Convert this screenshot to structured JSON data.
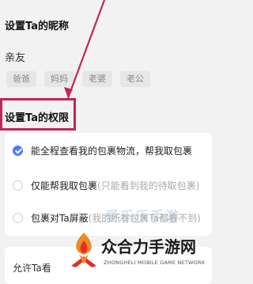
{
  "nickname_section": {
    "title": "设置Ta的昵称",
    "value": "亲友",
    "chips": [
      "爸爸",
      "妈妈",
      "老婆",
      "老公"
    ]
  },
  "permission_section": {
    "title": "设置Ta的权限",
    "options": [
      {
        "main": "能全程查看我的包裹物流，帮我取包裹",
        "sub": "",
        "selected": true
      },
      {
        "main": "仅能帮我取包裹",
        "sub": "(只能看到我的待取包裹)",
        "selected": false
      },
      {
        "main": "包裹对Ta屏蔽",
        "sub": "(我的所有包裹Ta都看不到)",
        "selected": false
      }
    ]
  },
  "allow_row": {
    "label": "允许Ta看"
  },
  "watermark": {
    "text": "爱乐乐手游"
  },
  "brand": {
    "cn": "众合力手游网",
    "en": "ZHONGHELI MOBILE GAME NETWORK"
  },
  "colors": {
    "accent": "#4c7cf3",
    "highlight": "#c2255c",
    "brand_orange": "#f08a24",
    "brand_red": "#e0302a"
  }
}
